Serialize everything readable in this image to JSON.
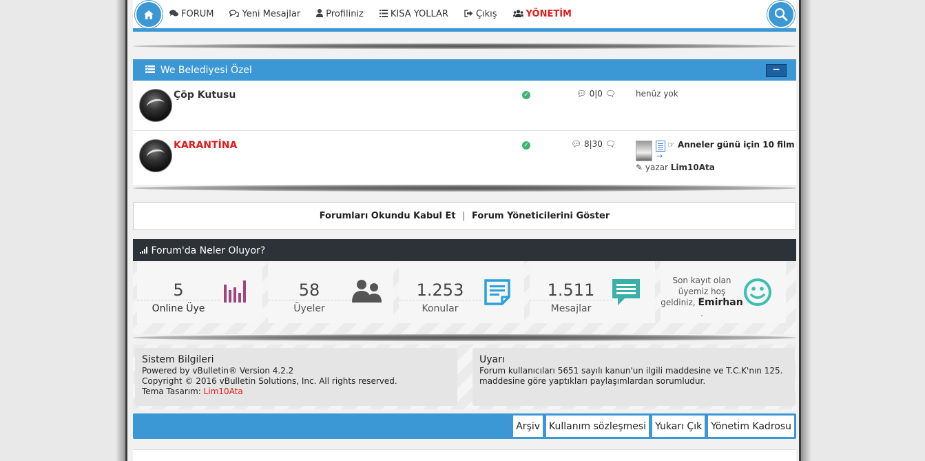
{
  "nav": {
    "items": [
      {
        "icon": "comments-icon",
        "label": "FORUM"
      },
      {
        "icon": "chat-icon",
        "label": "Yeni Mesajlar"
      },
      {
        "icon": "user-icon",
        "label": "Profiliniz"
      },
      {
        "icon": "list-icon",
        "label": "KISA YOLLAR"
      },
      {
        "icon": "sign-out-icon",
        "label": "Çıkış"
      },
      {
        "icon": "users-icon",
        "label": "YÖNETİM"
      }
    ]
  },
  "category": {
    "title": "We           Belediyesi Özel",
    "collapse_label": "−",
    "forums": [
      {
        "name": "Çöp Kutusu",
        "threads": "0",
        "posts": "0",
        "last_post": "henüz yok"
      },
      {
        "name": "KARANTİNA",
        "threads": "8",
        "posts": "30",
        "last_title": "Anneler günü için 10 film",
        "last_by_prefix": "yazar",
        "last_by_user": "Lim10Ata"
      }
    ]
  },
  "links": {
    "mark_read": "Forumları Okundu Kabul Et",
    "separator": "|",
    "show_mods": "Forum Yöneticilerini Göster"
  },
  "wol": {
    "title": "Forum'da Neler Oluyor?",
    "stats": [
      {
        "value": "5",
        "label": "Online Üye",
        "icon": "bar-chart-icon",
        "color": "#a0457e"
      },
      {
        "value": "58",
        "label": "Üyeler",
        "icon": "members-icon",
        "color": "#555555"
      },
      {
        "value": "1.253",
        "label": "Konular",
        "icon": "topic-icon",
        "color": "#2aa1d9"
      },
      {
        "value": "1.511",
        "label": "Mesajlar",
        "icon": "message-icon",
        "color": "#3bb0a8"
      }
    ],
    "welcome_line1": "Son kayıt olan",
    "welcome_line2": "üyemiz hoş",
    "welcome_line3": "geldiniz,",
    "welcome_user": "Emirhan",
    "welcome_dot": ".",
    "smile_color": "#3bbfb0"
  },
  "system": {
    "title": "Sistem Bilgileri",
    "line1": "Powered by vBulletin® Version 4.2.2",
    "line2": "Copyright © 2016 vBulletin Solutions, Inc. All rights reserved.",
    "line3_prefix": "Tema Tasarım:",
    "line3_author": "Lim10Ata"
  },
  "warning": {
    "title": "Uyarı",
    "text": "Forum kullanıcıları 5651 sayılı kanun'un ilgili maddesine ve T.C.K'nın 125. maddesine göre yaptıkları paylaşımlardan sorumludur."
  },
  "footer": {
    "links": [
      "Arşiv",
      "Kullanım sözleşmesi",
      "Yukarı Çık",
      "Yönetim Kadrosu"
    ]
  },
  "colors": {
    "accent": "#3c97d5",
    "danger": "#e01b1b",
    "dark_header": "#2d3238"
  }
}
